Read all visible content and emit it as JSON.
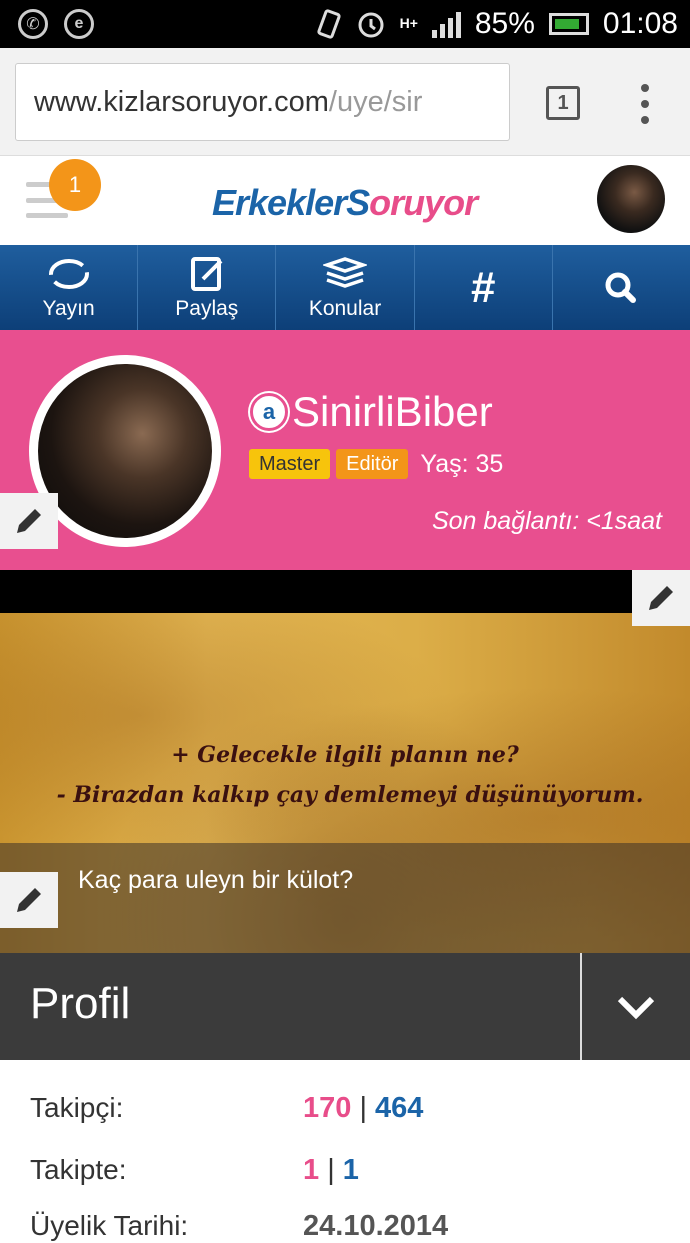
{
  "status_bar": {
    "battery": "85%",
    "time": "01:08",
    "network": "H+"
  },
  "browser": {
    "url_main": "www.kizlarsoruyor.com",
    "url_path": "/uye/sir",
    "tab_count": "1"
  },
  "header": {
    "notification_count": "1",
    "logo_part1": "ErkeklerS",
    "logo_part2": "o",
    "logo_part3": "ruyor"
  },
  "nav": {
    "items": [
      {
        "label": "Yayın"
      },
      {
        "label": "Paylaş"
      },
      {
        "label": "Konular"
      },
      {
        "label": "#"
      },
      {
        "label": ""
      }
    ]
  },
  "profile": {
    "username": "SinirliBiber",
    "badge_master": "Master",
    "badge_editor": "Editör",
    "age": "Yaş: 35",
    "last_seen": "Son bağlantı: <1saat"
  },
  "cover": {
    "quote_line1": "+ Gelecekle ilgili planın ne?",
    "quote_line2": "- Birazdan kalkıp çay demlemeyi düşünüyorum.",
    "status_text": "Kaç para uleyn bir külot?"
  },
  "section": {
    "title": "Profil"
  },
  "stats": {
    "followers_label": "Takipçi:",
    "followers_a": "170",
    "followers_b": "464",
    "following_label": "Takipte:",
    "following_a": "1",
    "following_b": "1",
    "member_label": "Üyelik Tarihi:",
    "member_date": "24.10.2014"
  },
  "colors": {
    "pink": "#e84f8f",
    "nav_blue": "#1b64a8",
    "orange": "#f39519",
    "yellow": "#f7c40c",
    "dark": "#3b3b3b"
  }
}
